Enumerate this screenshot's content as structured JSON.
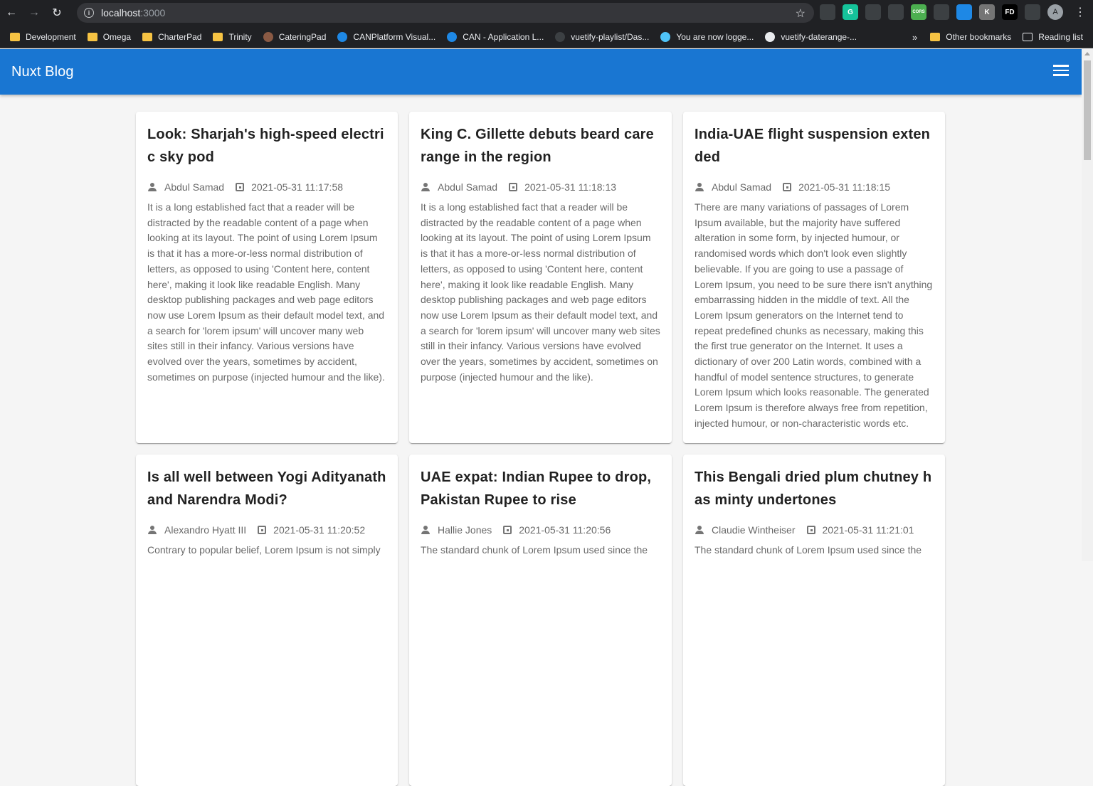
{
  "browser": {
    "url_host": "localhost",
    "url_port": ":3000",
    "profile_initial": "A",
    "extensions": [
      {
        "name": "pen-icon",
        "label": "",
        "color": "#3c4043"
      },
      {
        "name": "grammarly-icon",
        "label": "G",
        "color": "#15c39a"
      },
      {
        "name": "recycle-icon",
        "label": "",
        "color": "#3c4043"
      },
      {
        "name": "camera-icon",
        "label": "",
        "color": "#3c4043"
      },
      {
        "name": "cors-icon",
        "label": "CORS",
        "color": "#4caf50"
      },
      {
        "name": "nuxt-icon",
        "label": "",
        "color": "#3c4043"
      },
      {
        "name": "download-icon",
        "label": "",
        "color": "#1e88e5"
      },
      {
        "name": "k-icon",
        "label": "K",
        "color": "#757575"
      },
      {
        "name": "fd-icon",
        "label": "FD",
        "color": "#000000"
      },
      {
        "name": "puzzle-icon",
        "label": "",
        "color": "#3c4043"
      }
    ]
  },
  "bookmarks": [
    {
      "label": "Development",
      "type": "folder"
    },
    {
      "label": "Omega",
      "type": "folder"
    },
    {
      "label": "CharterPad",
      "type": "folder"
    },
    {
      "label": "Trinity",
      "type": "folder"
    },
    {
      "label": "CateringPad",
      "type": "site"
    },
    {
      "label": "CANPlatform Visual...",
      "type": "site"
    },
    {
      "label": "CAN - Application L...",
      "type": "site"
    },
    {
      "label": "vuetify-playlist/Das...",
      "type": "site"
    },
    {
      "label": "You are now logge...",
      "type": "site"
    },
    {
      "label": "vuetify-daterange-...",
      "type": "site"
    }
  ],
  "bookmarks_right": {
    "overflow": "»",
    "other": "Other bookmarks",
    "reading": "Reading list"
  },
  "app": {
    "title": "Nuxt Blog",
    "primary_color": "#1976d2"
  },
  "posts": [
    {
      "title": "Look: Sharjah's high-speed electric sky pod",
      "author": "Abdul Samad",
      "date": "2021-05-31 11:17:58",
      "body": "It is a long established fact that a reader will be distracted by the readable content of a page when looking at its layout. The point of using Lorem Ipsum is that it has a more-or-less normal distribution of letters, as opposed to using 'Content here, content here', making it look like readable English. Many desktop publishing packages and web page editors now use Lorem Ipsum as their default model text, and a search for 'lorem ipsum' will uncover many web sites still in their infancy. Various versions have evolved over the years, sometimes by accident, sometimes on purpose (injected humour and the like)."
    },
    {
      "title": "King C. Gillette debuts beard care range in the region",
      "author": "Abdul Samad",
      "date": "2021-05-31 11:18:13",
      "body": "It is a long established fact that a reader will be distracted by the readable content of a page when looking at its layout. The point of using Lorem Ipsum is that it has a more-or-less normal distribution of letters, as opposed to using 'Content here, content here', making it look like readable English. Many desktop publishing packages and web page editors now use Lorem Ipsum as their default model text, and a search for 'lorem ipsum' will uncover many web sites still in their infancy. Various versions have evolved over the years, sometimes by accident, sometimes on purpose (injected humour and the like)."
    },
    {
      "title": "India-UAE flight suspension extended",
      "author": "Abdul Samad",
      "date": "2021-05-31 11:18:15",
      "body": "There are many variations of passages of Lorem Ipsum available, but the majority have suffered alteration in some form, by injected humour, or randomised words which don't look even slightly believable. If you are going to use a passage of Lorem Ipsum, you need to be sure there isn't anything embarrassing hidden in the middle of text. All the Lorem Ipsum generators on the Internet tend to repeat predefined chunks as necessary, making this the first true generator on the Internet. It uses a dictionary of over 200 Latin words, combined with a handful of model sentence structures, to generate Lorem Ipsum which looks reasonable. The generated Lorem Ipsum is therefore always free from repetition, injected humour, or non-characteristic words etc."
    },
    {
      "title": "Is all well between Yogi Adityanath and Narendra Modi?",
      "author": "Alexandro Hyatt III",
      "date": "2021-05-31 11:20:52",
      "body": "Contrary to popular belief, Lorem Ipsum is not simply"
    },
    {
      "title": "UAE expat: Indian Rupee to drop, Pakistan Rupee to rise",
      "author": "Hallie Jones",
      "date": "2021-05-31 11:20:56",
      "body": "The standard chunk of Lorem Ipsum used since the"
    },
    {
      "title": "This Bengali dried plum chutney has minty undertones",
      "author": "Claudie Wintheiser",
      "date": "2021-05-31 11:21:01",
      "body": "The standard chunk of Lorem Ipsum used since the"
    }
  ]
}
